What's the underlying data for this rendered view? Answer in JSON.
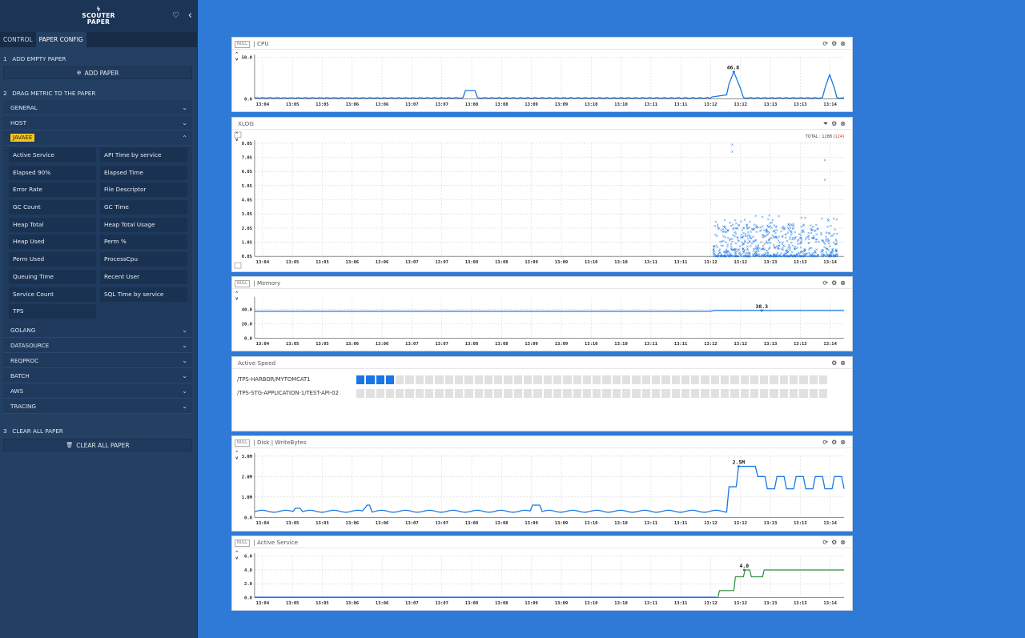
{
  "sidebar": {
    "logo_line1": "SCOUTER",
    "logo_line2": "PAPER",
    "tabs": [
      {
        "label": "CONTROL"
      },
      {
        "label": "PAPER CONFIG"
      }
    ],
    "step1": {
      "num": "1",
      "label": "ADD EMPTY PAPER",
      "button": "ADD PAPER"
    },
    "step2": {
      "num": "2",
      "label": "DRAG METRIC TO THE PAPER"
    },
    "step3": {
      "num": "3",
      "label": "CLEAR ALL PAPER",
      "button": "CLEAR ALL PAPER"
    },
    "categories_top": [
      "GENERAL",
      "HOST"
    ],
    "javaee_label": "JAVAEE",
    "metrics": [
      "Active Service",
      "API Time by service",
      "Elapsed 90%",
      "Elapsed Time",
      "Error Rate",
      "File Descriptor",
      "GC Count",
      "GC Time",
      "Heap Total",
      "Heap Total Usage",
      "Heap Used",
      "Perm %",
      "Perm Used",
      "ProcessCpu",
      "Queuing Time",
      "Recent User",
      "Service Count",
      "SQL Time by service",
      "TPS"
    ],
    "categories_bottom": [
      "GOLANG",
      "DATASOURCE",
      "REQPROC",
      "BATCH",
      "AWS",
      "TRACING"
    ]
  },
  "colors": {
    "accent": "#1877e6",
    "active_service_line": "#2e8b3e",
    "sidebar_bg": "#233f61",
    "page_bg": "#2f7ad6"
  },
  "panels": {
    "cpu": {
      "null_tag": "NULL",
      "title": "| CPU",
      "yticks": [
        "50.0",
        "0.0"
      ],
      "peak_label": "46.8"
    },
    "xlog": {
      "title": "XLOG",
      "total_prefix": "TOTAL : 1288 (",
      "total_error": "124",
      "total_suffix": ")",
      "yticks": [
        "8.0S",
        "7.0S",
        "6.0S",
        "5.0S",
        "4.0S",
        "3.0S",
        "2.0S",
        "1.0S",
        "0.0S"
      ]
    },
    "memory": {
      "null_tag": "NULL",
      "title": "| Memory",
      "yticks": [
        "40.0",
        "20.0",
        "0.0"
      ],
      "peak_label": "38.3"
    },
    "active_speed": {
      "title": "Active Speed",
      "rows": [
        {
          "label": "/TPS-HARBOR/MYTOMCAT1",
          "active": 4
        },
        {
          "label": "/TPS-STG-APPLICATION-1/TEST-API-02",
          "active": 0
        }
      ]
    },
    "disk": {
      "null_tag": "NULL",
      "title": "| Disk | WriteBytes",
      "yticks": [
        "3.0M",
        "2.0M",
        "1.0M",
        "0.0"
      ],
      "peak_label": "2.5M"
    },
    "active_service": {
      "null_tag": "NULL",
      "title": "| Active Service",
      "yticks": [
        "6.0",
        "4.0",
        "2.0",
        "0.0"
      ],
      "peak_label": "4.0"
    }
  },
  "time_ticks": [
    "13:04",
    "13:05",
    "13:05",
    "13:06",
    "13:06",
    "13:07",
    "13:07",
    "13:08",
    "13:08",
    "13:09",
    "13:09",
    "13:10",
    "13:10",
    "13:11",
    "13:11",
    "13:12",
    "13:12",
    "13:13",
    "13:13",
    "13:14"
  ]
}
